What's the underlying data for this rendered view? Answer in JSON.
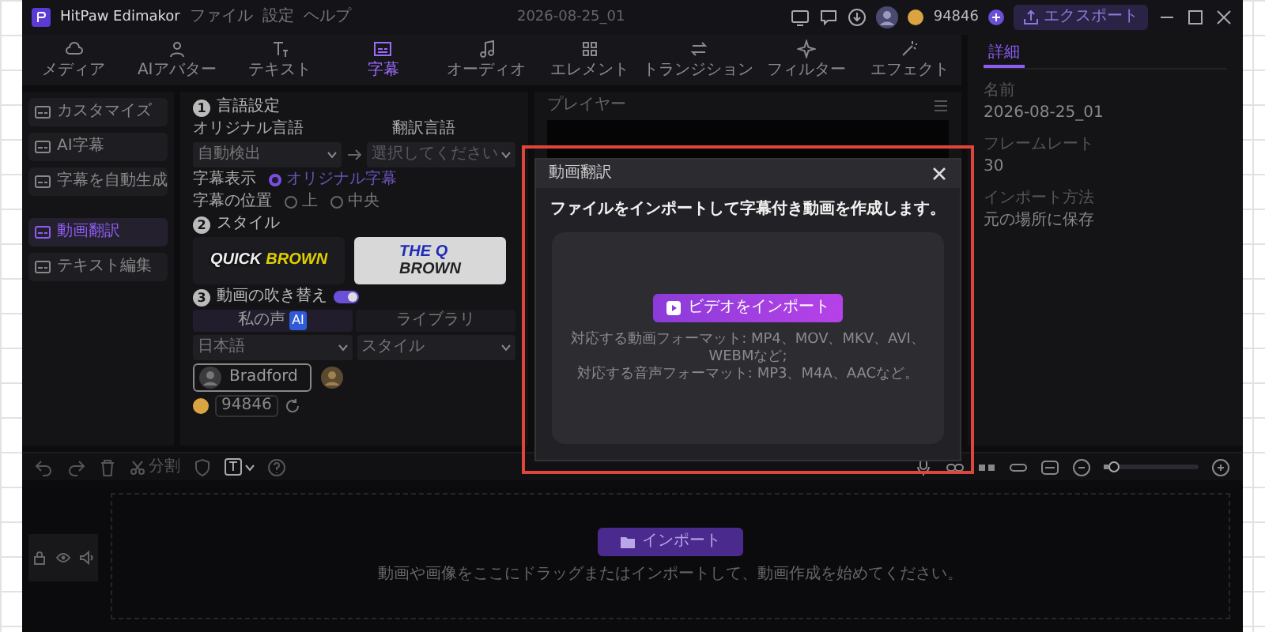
{
  "title_bar": {
    "app_name": "HitPaw Edimakor",
    "menu": [
      "ファイル",
      "設定",
      "ヘルプ"
    ],
    "project_name": "2026-08-25_01",
    "coins": "94846",
    "export_button": "エクスポート"
  },
  "tabs": [
    {
      "label": "メディア",
      "selected": false
    },
    {
      "label": "AIアバター",
      "selected": false
    },
    {
      "label": "テキスト",
      "selected": false
    },
    {
      "label": "字幕",
      "selected": true
    },
    {
      "label": "オーディオ",
      "selected": false
    },
    {
      "label": "エレメント",
      "selected": false
    },
    {
      "label": "トランジション",
      "selected": false
    },
    {
      "label": "フィルター",
      "selected": false
    },
    {
      "label": "エフェクト",
      "selected": false
    }
  ],
  "sidebar": {
    "items": [
      {
        "label": "カスタマイズ",
        "selected": false
      },
      {
        "label": "AI字幕",
        "selected": false
      },
      {
        "label": "字幕を自動生成",
        "selected": false
      },
      {
        "label": "動画翻訳",
        "selected": true
      },
      {
        "label": "テキスト編集",
        "selected": false
      }
    ]
  },
  "language_section": {
    "number": "1",
    "title": "言語設定",
    "original_label": "オリジナル言語",
    "original_value": "自動検出",
    "translated_label": "翻訳言語",
    "translated_placeholder": "選択してください",
    "display_label": "字幕表示",
    "display_options": [
      {
        "label": "オリジナル字幕",
        "selected": true
      }
    ],
    "position_label": "字幕の位置",
    "position_options": [
      {
        "label": "上",
        "selected": false
      },
      {
        "label": "中央",
        "selected": false
      }
    ]
  },
  "style_section": {
    "number": "2",
    "title": "スタイル",
    "styles": [
      {
        "kind": "neon",
        "words": [
          "QUICK",
          "BROWN"
        ]
      },
      {
        "kind": "comic",
        "words": [
          "THE Q",
          "BROWN"
        ]
      }
    ]
  },
  "dubbing_section": {
    "number": "3",
    "title": "動画の吹き替え",
    "toggle_on": true,
    "voice_tabs": [
      {
        "label": "私の声",
        "badge": "AI",
        "selected": true
      },
      {
        "label": "ライブラリ",
        "selected": false
      }
    ],
    "language_select": "日本語",
    "style_select": "スタイル",
    "voices": [
      {
        "name": "Bradford",
        "selected": true
      }
    ],
    "credits": "94846"
  },
  "player": {
    "title": "プレイヤー"
  },
  "details": {
    "tab": "詳細",
    "fields": [
      {
        "label": "名前",
        "value": "2026-08-25_01"
      },
      {
        "label": "フレームレート",
        "value": "30"
      },
      {
        "label": "インポート方法",
        "value": "元の場所に保存"
      }
    ]
  },
  "timeline": {
    "split_label": "分割",
    "text_tool": "T",
    "zoom": {
      "level": 0.05
    },
    "import_button": "インポート",
    "hint": "動画や画像をここにドラッグまたはインポートして、動画作成を始めてください。"
  },
  "dialog": {
    "title": "動画翻訳",
    "heading": "ファイルをインポートして字幕付き動画を作成します。",
    "import_button": "ビデオをインポート",
    "formats": [
      "対応する動画フォーマット: MP4、MOV、MKV、AVI、WEBMなど;",
      "対応する音声フォーマット: MP3、M4A、AACなど。"
    ]
  }
}
